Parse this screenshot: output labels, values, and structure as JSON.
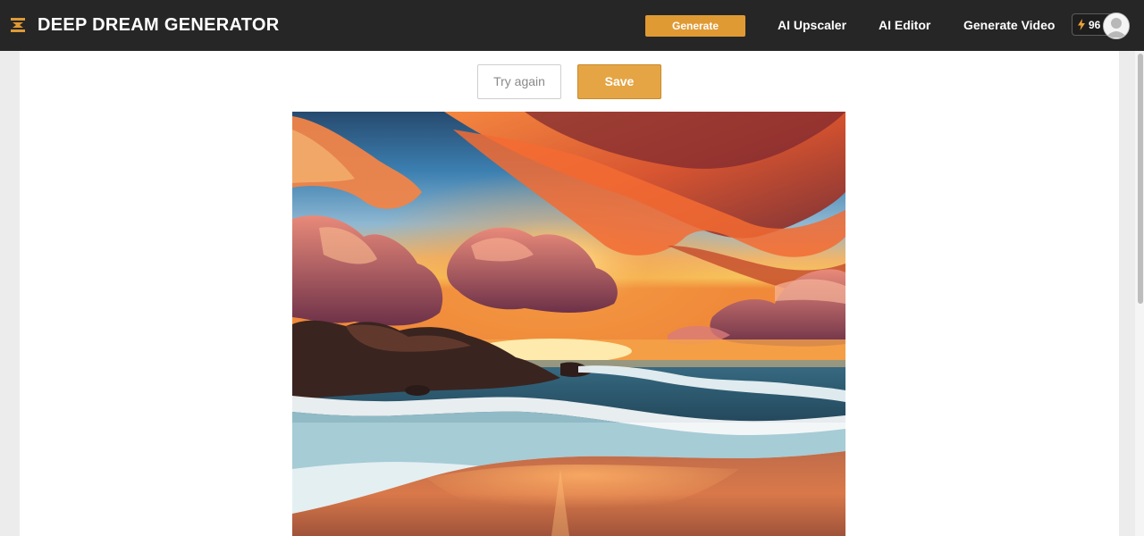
{
  "header": {
    "brand": "DEEP DREAM GENERATOR",
    "generate_label": "Generate",
    "nav": [
      {
        "label": "AI Upscaler"
      },
      {
        "label": "AI Editor"
      },
      {
        "label": "Generate Video"
      }
    ],
    "credits": "96",
    "icons": {
      "menu": "hourglass-menu-icon",
      "credits": "lightning-bolt-icon",
      "avatar": "user-avatar-icon"
    }
  },
  "actions": {
    "try_again_label": "Try again",
    "save_label": "Save"
  },
  "colors": {
    "header_bg": "#262626",
    "accent": "#e09a34",
    "save_accent": "#e5a544",
    "page_bg": "#ececec",
    "panel_bg": "#ffffff"
  }
}
